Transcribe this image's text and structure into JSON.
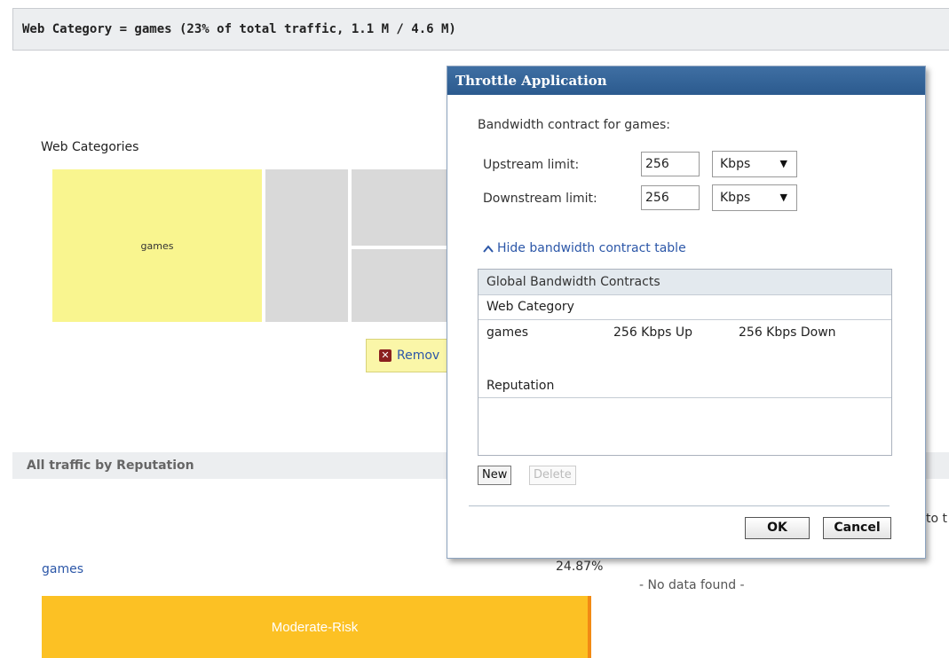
{
  "header": {
    "title": "Web Category = games (23% of total traffic, 1.1 M / 4.6 M)"
  },
  "web_categories": {
    "title": "Web Categories",
    "tiles": [
      "games"
    ],
    "remove_label": "Remov"
  },
  "reputation_section": {
    "title": "All traffic by Reputation",
    "side_text": "to t"
  },
  "reputation": {
    "category_link": "games",
    "percent": "24.87%",
    "bar_label": "Moderate-Risk",
    "share": 0.2487
  },
  "no_data": "- No data found -",
  "dialog": {
    "title": "Throttle Application",
    "subtitle": "Bandwidth contract for games:",
    "upstream_label": "Upstream limit:",
    "upstream_value": "256",
    "upstream_unit": "Kbps",
    "downstream_label": "Downstream limit:",
    "downstream_value": "256",
    "downstream_unit": "Kbps",
    "toggle_label": "Hide bandwidth contract table",
    "table": {
      "header": "Global Bandwidth Contracts",
      "group_web": "Web Category",
      "row": {
        "name": "games",
        "up": "256 Kbps Up",
        "down": "256 Kbps Down"
      },
      "group_rep": "Reputation"
    },
    "new_label": "New",
    "delete_label": "Delete",
    "ok_label": "OK",
    "cancel_label": "Cancel"
  },
  "colors": {
    "games_tile": "#f9f58f",
    "risk_bar": "#fcc124",
    "dialog_title": "#2b5a8e"
  },
  "icons": [
    "remove-x-icon",
    "chevron-up-icon",
    "dropdown-caret-icon"
  ]
}
